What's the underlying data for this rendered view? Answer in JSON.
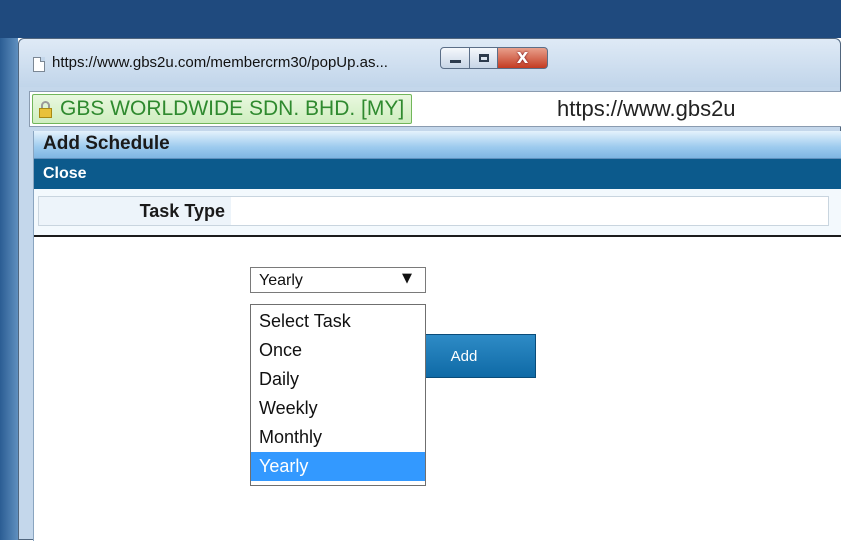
{
  "window": {
    "title": "https://www.gbs2u.com/membercrm30/popUp.as...",
    "close_glyph": "X"
  },
  "address_bar": {
    "certificate": "GBS WORLDWIDE SDN. BHD. [MY]",
    "url": "https://www.gbs2u"
  },
  "dialog": {
    "title": "Add Schedule",
    "close_label": "Close",
    "task_type_label": "Task Type",
    "task_type_value": "Yearly",
    "task_type_options": [
      {
        "label": "Select Task"
      },
      {
        "label": "Once"
      },
      {
        "label": "Daily"
      },
      {
        "label": "Weekly"
      },
      {
        "label": "Monthly"
      },
      {
        "label": "Yearly"
      }
    ],
    "selected_option": "Yearly",
    "add_button_label": "Add"
  },
  "colors": {
    "accent": "#0c5a8c",
    "selection": "#3399ff",
    "certificate_text": "#2f8a2f"
  }
}
